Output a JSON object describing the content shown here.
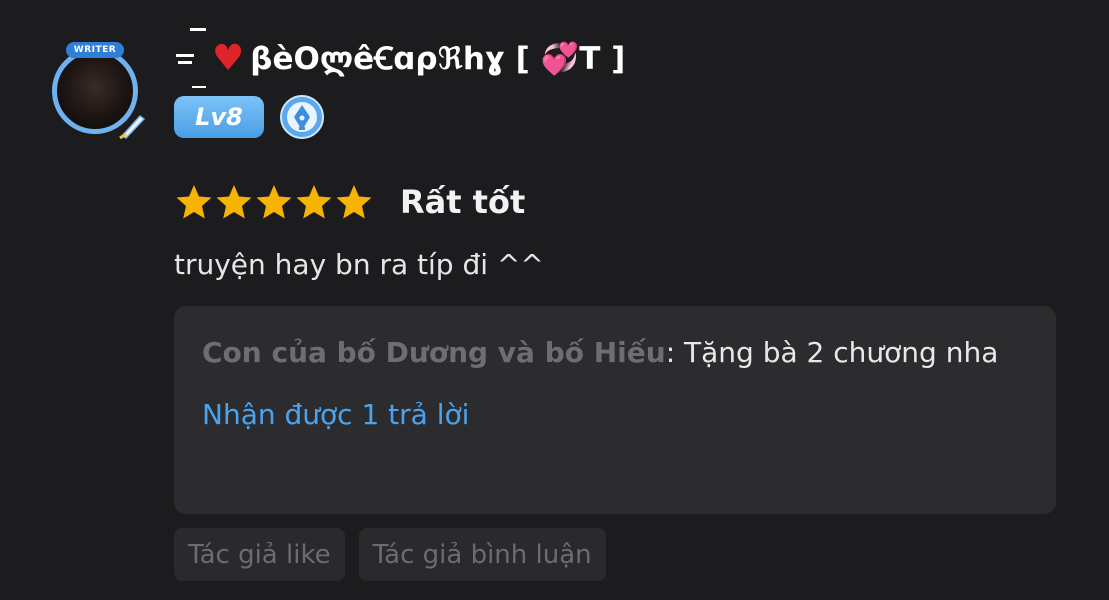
{
  "review": {
    "username": "βèΟლêꞒɑρℜhɣ [ 💞T ]",
    "level": "Lv8",
    "avatar_badge": "WRITER",
    "stars": 5,
    "rating_label": "Rất tốt",
    "comment": "truyện hay bn ra típ đi ^^"
  },
  "reply": {
    "author": "Con của bố Dương và bố Hiếu",
    "separator": ": ",
    "text": "Tặng bà 2 chương nha",
    "count_label": "Nhận được 1 trả lời"
  },
  "tags": [
    "Tác giả like",
    "Tác giả bình luận"
  ],
  "colors": {
    "background": "#1c1c1e",
    "star": "#f5b400",
    "link": "#4ba3f0",
    "level_badge": "#5aaaf0"
  },
  "icons": {
    "heart": "red-heart-icon",
    "writer": "pen-nib-icon",
    "sparkle_heart": "sparkling-heart-icon"
  }
}
